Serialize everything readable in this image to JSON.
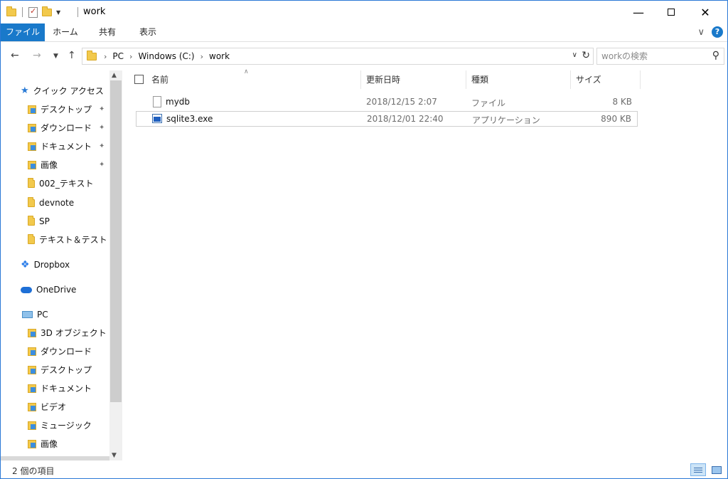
{
  "window": {
    "title": "work",
    "controls": {
      "minimize": "—",
      "close": "✕"
    }
  },
  "ribbon": {
    "tabs": [
      "ファイル",
      "ホーム",
      "共有",
      "表示"
    ]
  },
  "address": {
    "crumbs": [
      "PC",
      "Windows (C:)",
      "work"
    ]
  },
  "search": {
    "placeholder": "workの検索"
  },
  "nav": {
    "quick_access": "クイック アクセス",
    "quick_items": [
      "デスクトップ",
      "ダウンロード",
      "ドキュメント",
      "画像",
      "002_テキスト",
      "devnote",
      "SP",
      "テキスト＆テスト"
    ],
    "dropbox": "Dropbox",
    "onedrive": "OneDrive",
    "pc": "PC",
    "pc_items": [
      "3D オブジェクト",
      "ダウンロード",
      "デスクトップ",
      "ドキュメント",
      "ビデオ",
      "ミュージック",
      "画像"
    ]
  },
  "columns": {
    "name": "名前",
    "date": "更新日時",
    "type": "種類",
    "size": "サイズ"
  },
  "files": [
    {
      "name": "mydb",
      "date": "2018/12/15 2:07",
      "type": "ファイル",
      "size": "8 KB",
      "icon": "file-icon"
    },
    {
      "name": "sqlite3.exe",
      "date": "2018/12/01 22:40",
      "type": "アプリケーション",
      "size": "890 KB",
      "icon": "exe-icon"
    }
  ],
  "status": {
    "count_text": "2 個の項目"
  },
  "colors": {
    "accent": "#1979ca",
    "folder": "#f2c94c"
  }
}
